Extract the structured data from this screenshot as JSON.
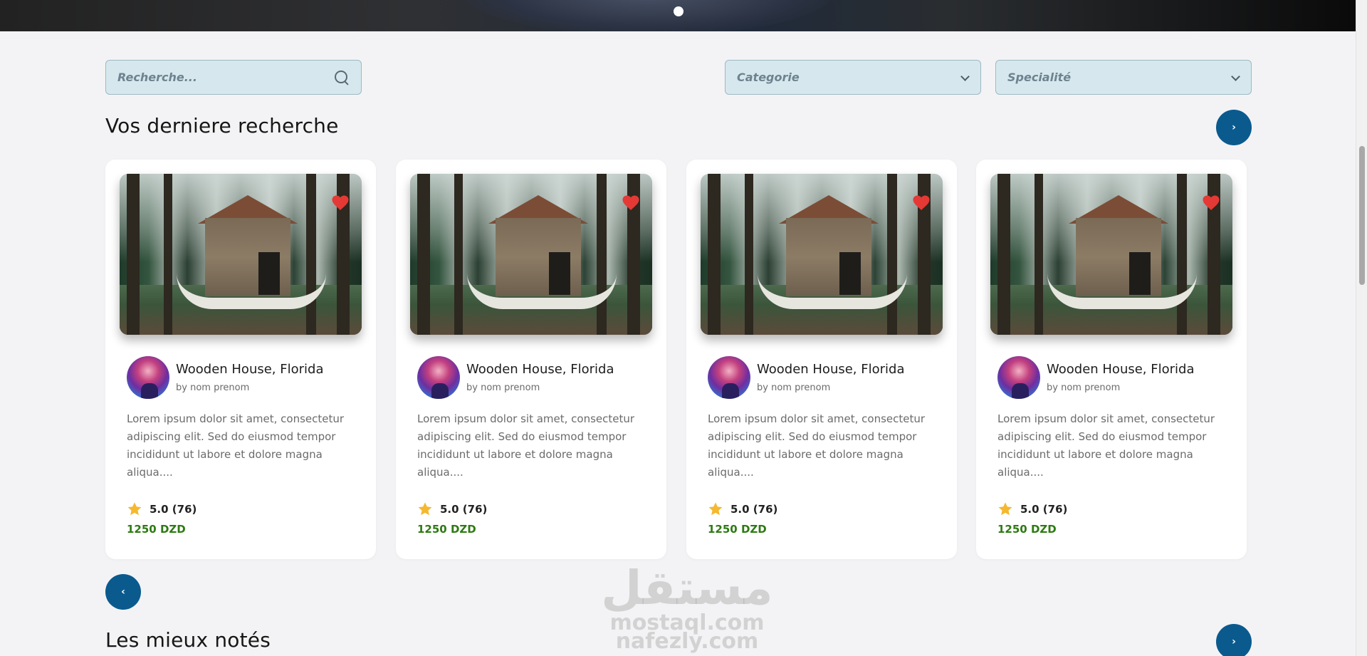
{
  "search": {
    "placeholder": "Recherche..."
  },
  "filters": {
    "category_label": "Categorie",
    "specialty_label": "Specialité"
  },
  "sections": {
    "recent_title": "Vos derniere recherche",
    "top_rated_title": "Les mieux notés"
  },
  "nav": {
    "next_symbol": "›",
    "prev_symbol": "‹"
  },
  "cards": [
    {
      "title": "Wooden House, Florida",
      "author": "by nom prenom",
      "description": "Lorem ipsum dolor sit amet, consectetur adipiscing elit. Sed do eiusmod tempor incididunt ut labore et dolore magna aliqua....",
      "rating": "5.0 (76)",
      "price": "1250 DZD",
      "favorite": true
    },
    {
      "title": "Wooden House, Florida",
      "author": "by nom prenom",
      "description": "Lorem ipsum dolor sit amet, consectetur adipiscing elit. Sed do eiusmod tempor incididunt ut labore et dolore magna aliqua....",
      "rating": "5.0 (76)",
      "price": "1250 DZD",
      "favorite": true
    },
    {
      "title": "Wooden House, Florida",
      "author": "by nom prenom",
      "description": "Lorem ipsum dolor sit amet, consectetur adipiscing elit. Sed do eiusmod tempor incididunt ut labore et dolore magna aliqua....",
      "rating": "5.0 (76)",
      "price": "1250 DZD",
      "favorite": true
    },
    {
      "title": "Wooden House, Florida",
      "author": "by nom prenom",
      "description": "Lorem ipsum dolor sit amet, consectetur adipiscing elit. Sed do eiusmod tempor incididunt ut labore et dolore magna aliqua....",
      "rating": "5.0 (76)",
      "price": "1250 DZD",
      "favorite": true
    }
  ],
  "watermark": {
    "logo": "مستقل",
    "line1": "mostaql.com",
    "line2": "nafezly.com"
  },
  "colors": {
    "accent": "#0a5a8e",
    "price": "#2d7a12",
    "heart": "#e53935",
    "star": "#f5b82e",
    "filter_bg": "#d6e8ee"
  },
  "icons": {
    "search": "search-icon",
    "dropdown": "chevron-down-icon",
    "favorite": "heart-icon",
    "rating": "star-icon"
  }
}
